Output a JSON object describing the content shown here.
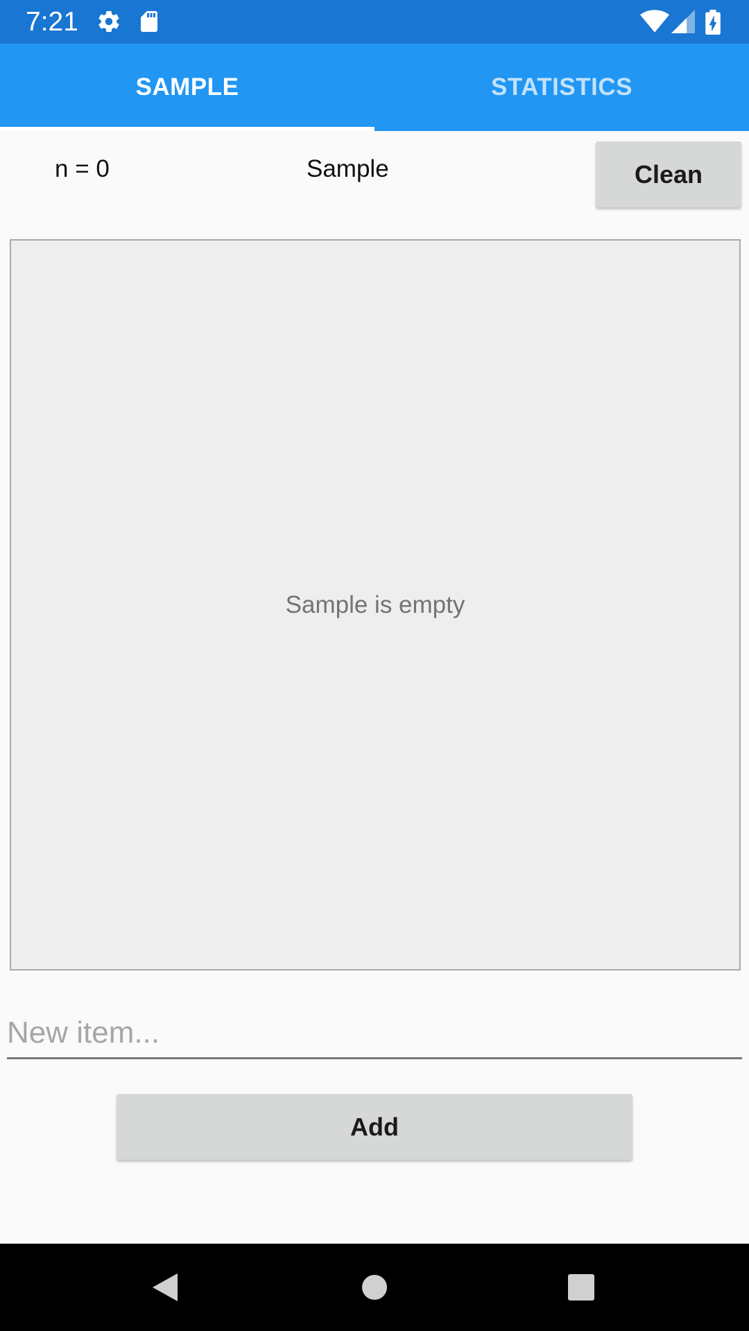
{
  "status_bar": {
    "time": "7:21",
    "left_icons": [
      "settings-icon",
      "sd-card-icon"
    ],
    "right_icons": [
      "wifi-icon",
      "cell-signal-icon",
      "battery-charging-icon"
    ],
    "background_color": "#1976d2"
  },
  "tabs": [
    {
      "label": "SAMPLE",
      "active": true
    },
    {
      "label": "STATISTICS",
      "active": false
    }
  ],
  "header": {
    "count_label": "n = 0",
    "title": "Sample",
    "clean_label": "Clean"
  },
  "list": {
    "empty_text": "Sample is empty"
  },
  "input": {
    "placeholder": "New item...",
    "value": ""
  },
  "add_label": "Add",
  "nav_bar": {
    "icons": [
      "back-icon",
      "home-icon",
      "recents-icon"
    ]
  },
  "colors": {
    "accent": "#2196f3",
    "status_bar": "#1976d2",
    "button": "#d6d7d7"
  }
}
